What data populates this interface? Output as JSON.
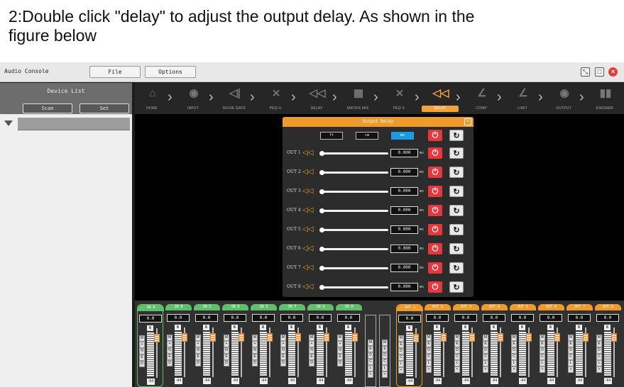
{
  "caption": {
    "line1": "2:Double click \"delay\" to adjust the output delay. As shown in the",
    "line2": "figure below"
  },
  "titlebar": {
    "app_name": "Audio Console",
    "file_label": "File",
    "options_label": "Options"
  },
  "sidebar": {
    "title": "Device List",
    "scan_label": "Scan",
    "set_label": "Set"
  },
  "flow": {
    "items": [
      {
        "label": "HOME",
        "icon": "home-icon",
        "glyph": "⌂"
      },
      {
        "label": "INPUT",
        "icon": "input-icon",
        "glyph": "◉"
      },
      {
        "label": "NOISE GATE",
        "icon": "noise-gate-icon",
        "glyph": "◁|"
      },
      {
        "label": "PEQ-X",
        "icon": "peq-icon",
        "glyph": "⨯"
      },
      {
        "label": "DELAY",
        "icon": "delay-icon",
        "glyph": "◁◁"
      },
      {
        "label": "MATRIX MIX",
        "icon": "matrix-icon",
        "glyph": "▦"
      },
      {
        "label": "PEQ-X",
        "icon": "peq-icon",
        "glyph": "⨯"
      },
      {
        "label": "DELAY",
        "icon": "delay-icon",
        "glyph": "◁◁",
        "active": true
      },
      {
        "label": "COMP",
        "icon": "comp-icon",
        "glyph": "∠"
      },
      {
        "label": "LIMIT",
        "icon": "limit-icon",
        "glyph": "∠"
      },
      {
        "label": "OUTPUT",
        "icon": "output-icon",
        "glyph": "◉"
      },
      {
        "label": "ENGINER",
        "icon": "engineer-icon",
        "glyph": "▮▮"
      }
    ]
  },
  "dialog": {
    "title": "Output Delay",
    "units": [
      "ft",
      "cm",
      "ms"
    ],
    "selected_unit": "ms",
    "accent": "#ee9a2c",
    "outputs": [
      {
        "label": "OUT 1",
        "value": "0.000",
        "unit": "ms"
      },
      {
        "label": "OUT 2",
        "value": "0.000",
        "unit": "ms"
      },
      {
        "label": "OUT 3",
        "value": "0.000",
        "unit": "ms"
      },
      {
        "label": "OUT 4",
        "value": "0.000",
        "unit": "ms"
      },
      {
        "label": "OUT 5",
        "value": "0.000",
        "unit": "ms"
      },
      {
        "label": "OUT 6",
        "value": "0.000",
        "unit": "ms"
      },
      {
        "label": "OUT 7",
        "value": "0.000",
        "unit": "ms"
      },
      {
        "label": "OUT 8",
        "value": "0.000",
        "unit": "ms"
      }
    ]
  },
  "mixer": {
    "inputs": [
      {
        "name": "IN A",
        "value": "0.0",
        "top": "6",
        "bottom": "-64",
        "letters": [
          "M",
          "+",
          "N",
          "E",
          "D"
        ]
      },
      {
        "name": "IN B",
        "value": "0.0",
        "top": "6",
        "bottom": "-64",
        "letters": [
          "M",
          "+",
          "N",
          "E",
          "D"
        ]
      },
      {
        "name": "IN C",
        "value": "0.0",
        "top": "6",
        "bottom": "-64",
        "letters": [
          "M",
          "+",
          "N",
          "E",
          "D"
        ]
      },
      {
        "name": "IN D",
        "value": "0.0",
        "top": "6",
        "bottom": "-64",
        "letters": [
          "M",
          "+",
          "N",
          "E",
          "D"
        ]
      },
      {
        "name": "IN E",
        "value": "0.0",
        "top": "6",
        "bottom": "-64",
        "letters": [
          "M",
          "+",
          "N",
          "E",
          "D"
        ]
      },
      {
        "name": "IN F",
        "value": "0.0",
        "top": "6",
        "bottom": "-64",
        "letters": [
          "M",
          "+",
          "N",
          "E",
          "D"
        ]
      },
      {
        "name": "IN G",
        "value": "0.0",
        "top": "6",
        "bottom": "-64",
        "letters": [
          "M",
          "+",
          "N",
          "E",
          "D"
        ]
      },
      {
        "name": "IN H",
        "value": "0.0",
        "top": "6",
        "bottom": "-64",
        "letters": [
          "M",
          "+",
          "N",
          "E",
          "D"
        ]
      }
    ],
    "stereo_letters": [
      "M",
      "E",
      "D",
      "C",
      "L",
      "+"
    ],
    "outputs": [
      {
        "name": "OUT 1",
        "value": "0.0",
        "top": "6",
        "bottom": "-64",
        "letters": [
          "M",
          "E",
          "D",
          "C",
          "L",
          "+"
        ]
      },
      {
        "name": "OUT 2",
        "value": "0.0",
        "top": "6",
        "bottom": "-64",
        "letters": [
          "M",
          "E",
          "D",
          "C",
          "L",
          "+"
        ]
      },
      {
        "name": "OUT 3",
        "value": "0.0",
        "top": "6",
        "bottom": "-64",
        "letters": [
          "M",
          "E",
          "D",
          "C",
          "L",
          "+"
        ]
      },
      {
        "name": "OUT 4",
        "value": "0.0",
        "top": "6",
        "bottom": "-64",
        "letters": [
          "M",
          "E",
          "D",
          "C",
          "L",
          "+"
        ]
      },
      {
        "name": "OUT 5",
        "value": "0.0",
        "top": "6",
        "bottom": "-64",
        "letters": [
          "M",
          "E",
          "D",
          "C",
          "L",
          "+"
        ]
      },
      {
        "name": "OUT 6",
        "value": "0.0",
        "top": "6",
        "bottom": "-64",
        "letters": [
          "M",
          "E",
          "D",
          "C",
          "L",
          "+"
        ]
      },
      {
        "name": "OUT 7",
        "value": "0.0",
        "top": "6",
        "bottom": "-64",
        "letters": [
          "M",
          "E",
          "D",
          "C",
          "L",
          "+"
        ]
      },
      {
        "name": "OUT 8",
        "value": "0.0",
        "top": "6",
        "bottom": "-64",
        "letters": [
          "M",
          "E",
          "D",
          "C",
          "L",
          "+"
        ]
      }
    ]
  }
}
